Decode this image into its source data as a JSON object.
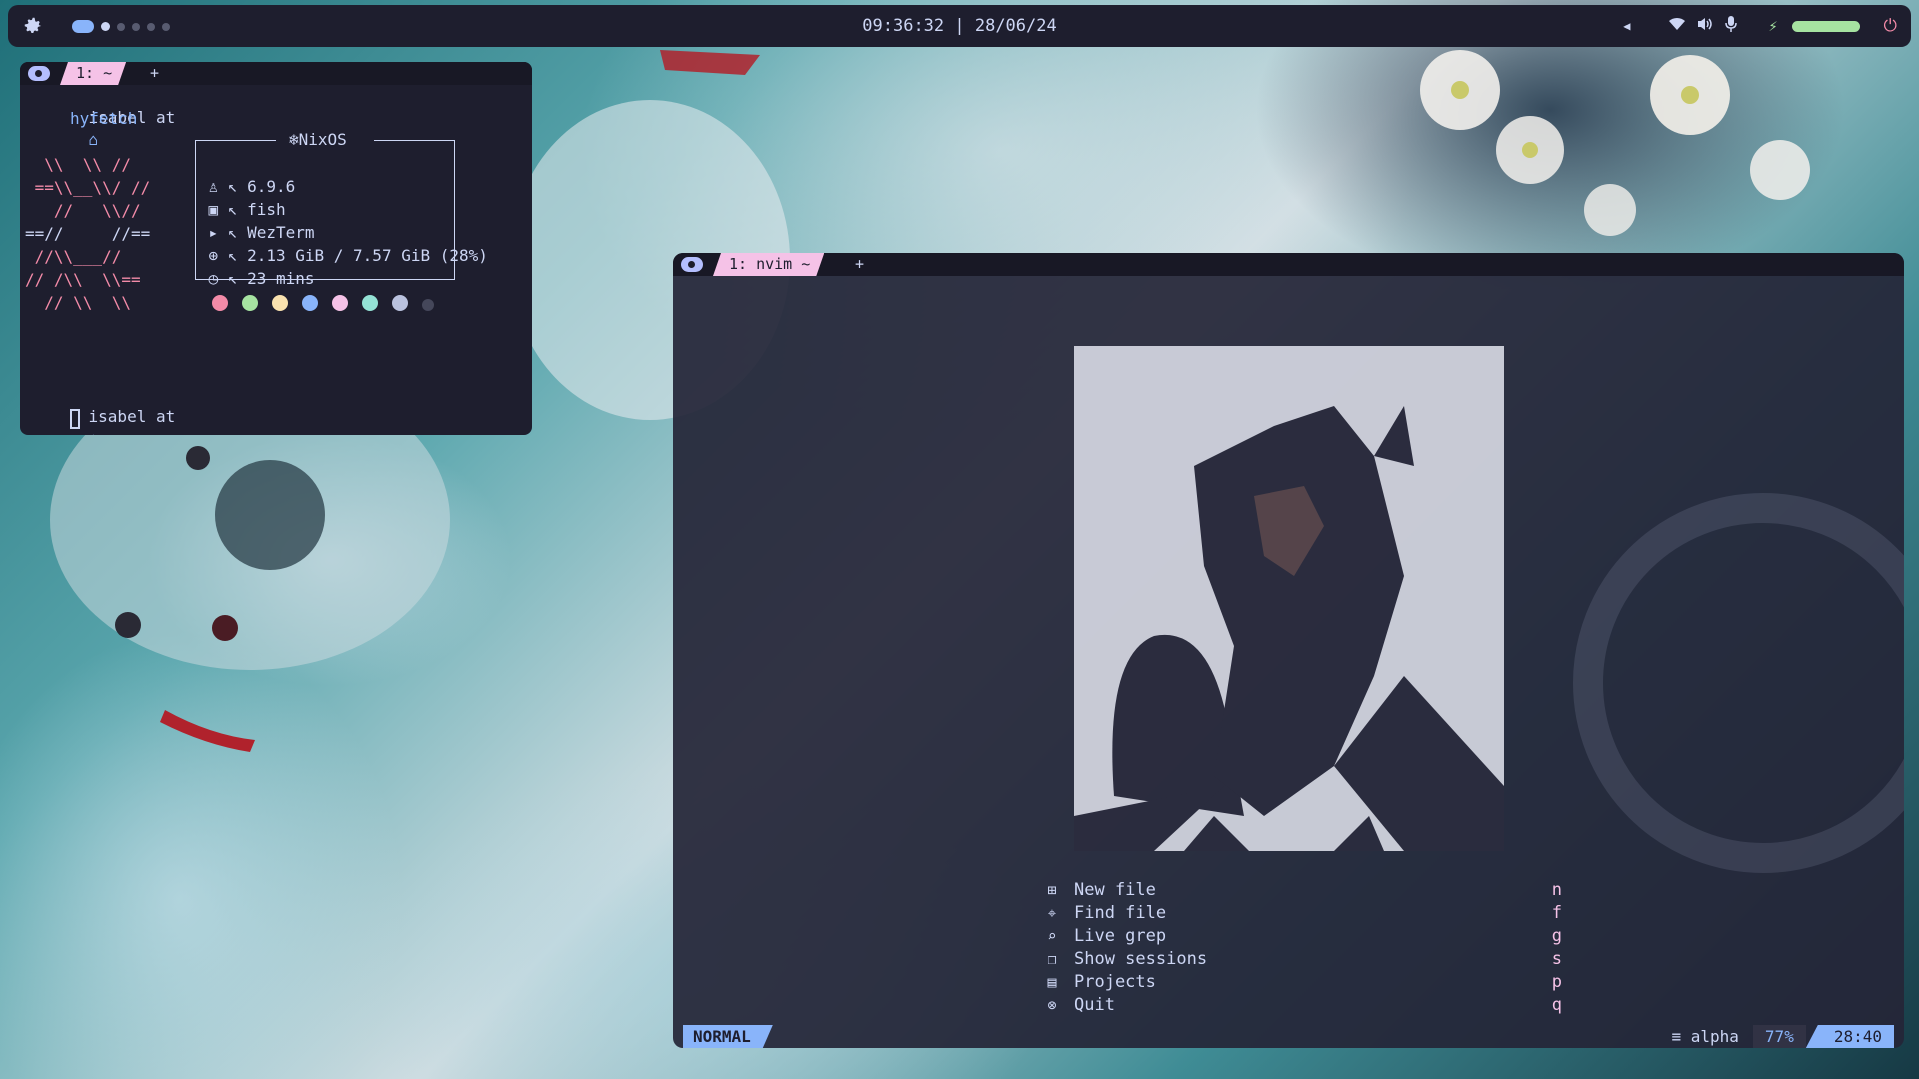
{
  "topbar": {
    "clock": "09:36:32 | 28/06/24",
    "settings_icon": "gear-icon",
    "workspaces": [
      "active",
      "occupied",
      "empty",
      "empty",
      "empty",
      "empty",
      "empty"
    ],
    "tray": [
      "chevron-left-icon",
      "wifi-icon",
      "volume-icon",
      "microphone-icon",
      "bolt-icon"
    ],
    "battery_level": 1.0,
    "power_icon": "power-icon"
  },
  "terminal1": {
    "tab_label": "1: ~",
    "tab_plus": "+",
    "prompt_user": "isabel at",
    "command": "hyfetch",
    "logo_lines": [
      "  \\\\  \\\\ //",
      " ==\\\\__\\\\/ //",
      "   //   \\\\//",
      "==//     //==",
      " //\\\\___//",
      "// /\\\\  \\\\==",
      "  // \\\\  \\\\"
    ],
    "os_title": "NixOS",
    "info": [
      {
        "icon": "penguin-icon",
        "value": "6.9.6"
      },
      {
        "icon": "terminal-icon",
        "value": "fish"
      },
      {
        "icon": "prompt-icon",
        "value": "WezTerm"
      },
      {
        "icon": "memory-icon",
        "value": "2.13 GiB / 7.57 GiB (28%)"
      },
      {
        "icon": "timer-icon",
        "value": "23 mins"
      }
    ],
    "swatches": [
      "#f38ba8",
      "#a6e3a1",
      "#f9e2af",
      "#89b4fa",
      "#f5c2e7",
      "#94e2d5",
      "#bac2de",
      "#45475a"
    ],
    "prompt2_user": "isabel at"
  },
  "nvim": {
    "tab_label": "1: nvim ~",
    "tab_plus": "+",
    "menu": [
      {
        "icon": "new-file-icon",
        "label": "New file",
        "key": "n"
      },
      {
        "icon": "telescope-icon",
        "label": "Find file",
        "key": "f"
      },
      {
        "icon": "search-icon",
        "label": "Live grep",
        "key": "g"
      },
      {
        "icon": "sessions-icon",
        "label": "Show sessions",
        "key": "s"
      },
      {
        "icon": "projects-icon",
        "label": "Projects",
        "key": "p"
      },
      {
        "icon": "quit-icon",
        "label": "Quit",
        "key": "q"
      }
    ],
    "status": {
      "mode": "NORMAL",
      "filetype": "alpha",
      "percent": "77%",
      "position": "28:40"
    }
  },
  "colors": {
    "base": "#1e1e2e",
    "mantle": "#181825",
    "text": "#cdd6f4",
    "blue": "#89b4fa",
    "pink": "#f5c2e7",
    "red": "#f38ba8",
    "green": "#a6e3a1"
  }
}
